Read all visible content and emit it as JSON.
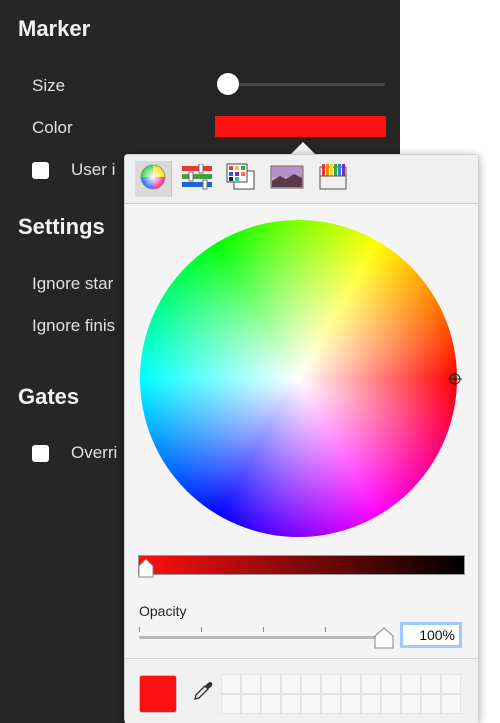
{
  "marker": {
    "title": "Marker",
    "size_label": "Size",
    "size_value_fraction": 0.05,
    "color_label": "Color",
    "color_value": "#ff1010",
    "user_checkbox_label": "User i"
  },
  "settings": {
    "title": "Settings",
    "ignore_start_label": "Ignore star",
    "ignore_finish_label": "Ignore finis"
  },
  "gates": {
    "title": "Gates",
    "override_label": "Overri"
  },
  "color_picker": {
    "tabs": [
      "color-wheel",
      "color-sliders",
      "color-palettes",
      "image-palettes",
      "crayons"
    ],
    "active_tab": "color-wheel",
    "brightness_fraction": 1.0,
    "opacity_label": "Opacity",
    "opacity_value": "100%",
    "current_color": "#ff1010"
  }
}
